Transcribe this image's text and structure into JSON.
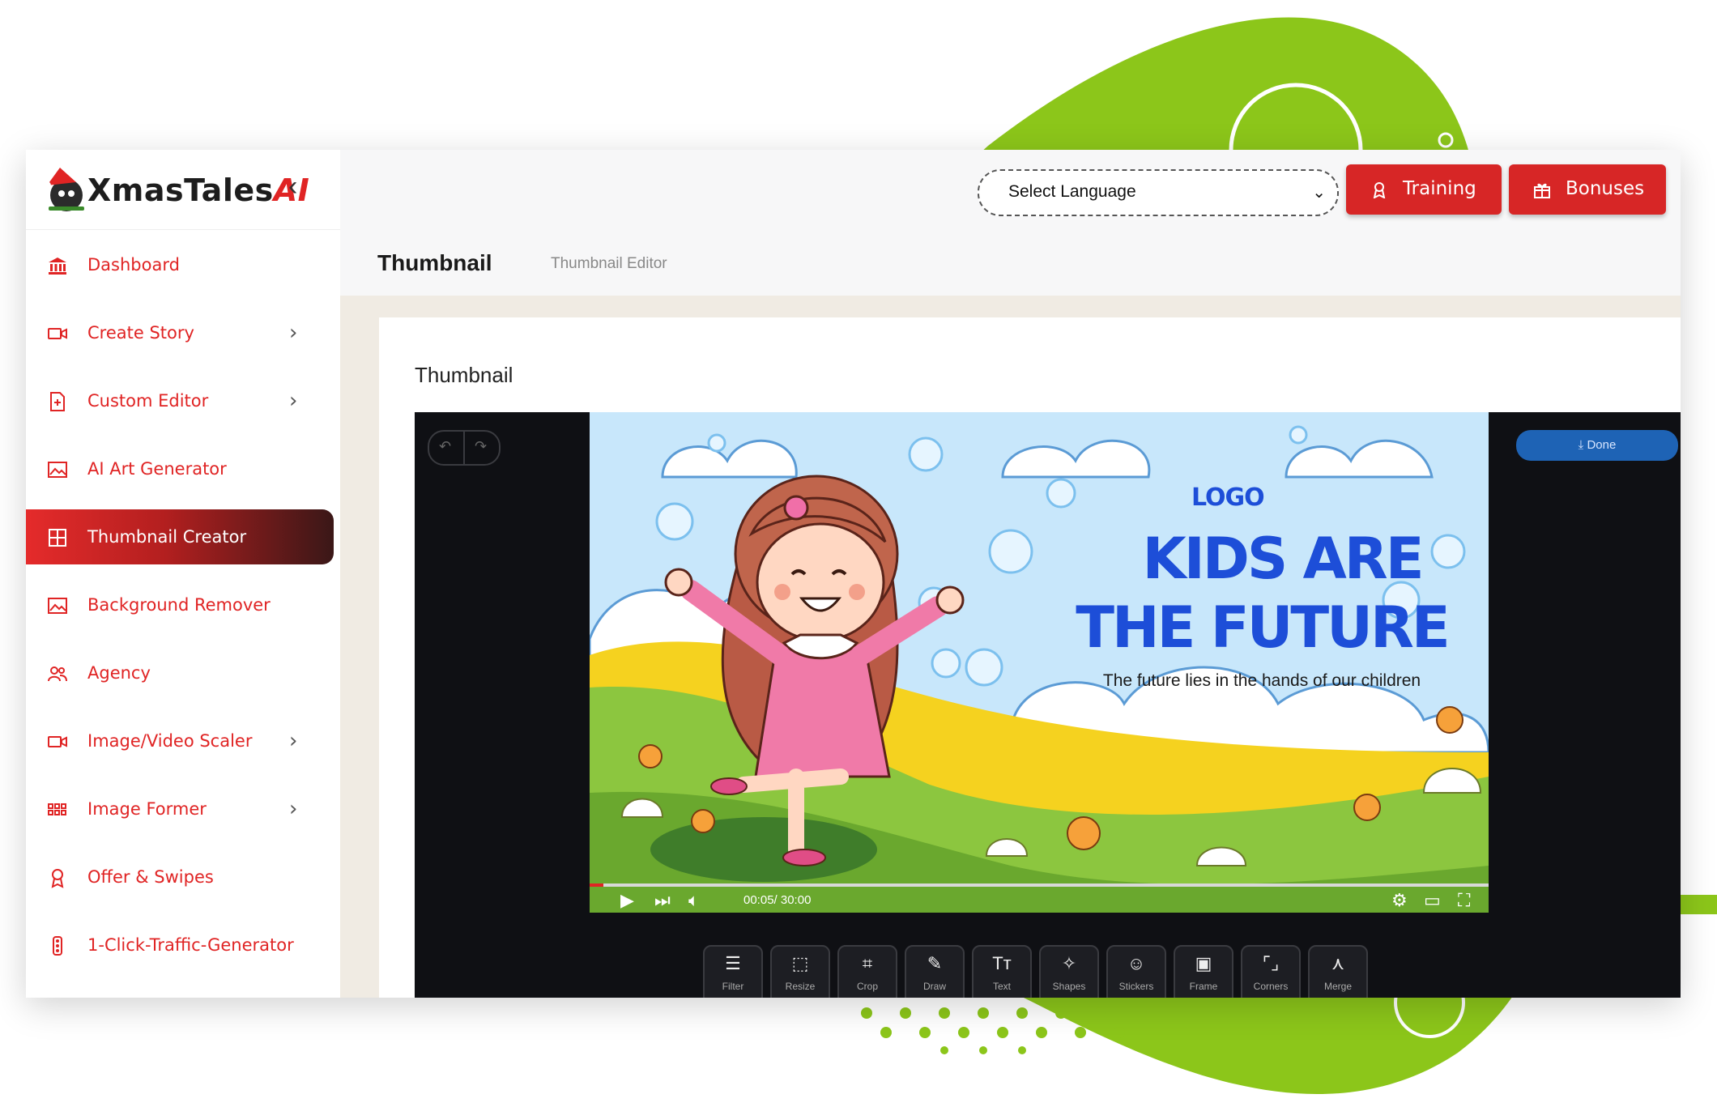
{
  "brand": {
    "name_prefix": "XmasTales",
    "name_suffix": "AI"
  },
  "topbar": {
    "language_select": "Select Language",
    "training_label": "Training",
    "bonuses_label": "Bonuses",
    "page_title": "Thumbnail",
    "page_subtitle": "Thumbnail Editor"
  },
  "sidebar": {
    "items": [
      {
        "label": "Dashboard",
        "icon": "bank-icon",
        "chevron": false,
        "active": false
      },
      {
        "label": "Create Story",
        "icon": "video-icon",
        "chevron": true,
        "active": false
      },
      {
        "label": "Custom Editor",
        "icon": "file-plus-icon",
        "chevron": true,
        "active": false
      },
      {
        "label": "AI Art Generator",
        "icon": "image-icon",
        "chevron": false,
        "active": false
      },
      {
        "label": "Thumbnail Creator",
        "icon": "grid-icon",
        "chevron": false,
        "active": true
      },
      {
        "label": "Background Remover",
        "icon": "image-icon",
        "chevron": false,
        "active": false
      },
      {
        "label": "Agency",
        "icon": "users-icon",
        "chevron": false,
        "active": false
      },
      {
        "label": "Image/Video Scaler",
        "icon": "video-icon",
        "chevron": true,
        "active": false
      },
      {
        "label": "Image Former",
        "icon": "apps-icon",
        "chevron": true,
        "active": false
      },
      {
        "label": "Offer & Swipes",
        "icon": "award-icon",
        "chevron": false,
        "active": false
      },
      {
        "label": "1-Click-Traffic-Generator",
        "icon": "traffic-icon",
        "chevron": false,
        "active": false
      }
    ]
  },
  "content": {
    "section_title": "Thumbnail"
  },
  "editor": {
    "done_label": "Done",
    "thumbnail": {
      "logo_text": "LOGO",
      "headline_line1": "KIDS ARE",
      "headline_line2": "THE FUTURE",
      "tagline": "The future lies in the hands of our children"
    },
    "player": {
      "time": "00:05/ 30:00",
      "progress": 0.015
    },
    "tools": [
      "Filter",
      "Resize",
      "Crop",
      "Draw",
      "Text",
      "Shapes",
      "Stickers",
      "Frame",
      "Corners",
      "Merge"
    ]
  },
  "colors": {
    "accent": "#e02424",
    "brand_green": "#8cc61a",
    "done_blue": "#1e63b5",
    "headline_blue": "#1d4ed8"
  }
}
